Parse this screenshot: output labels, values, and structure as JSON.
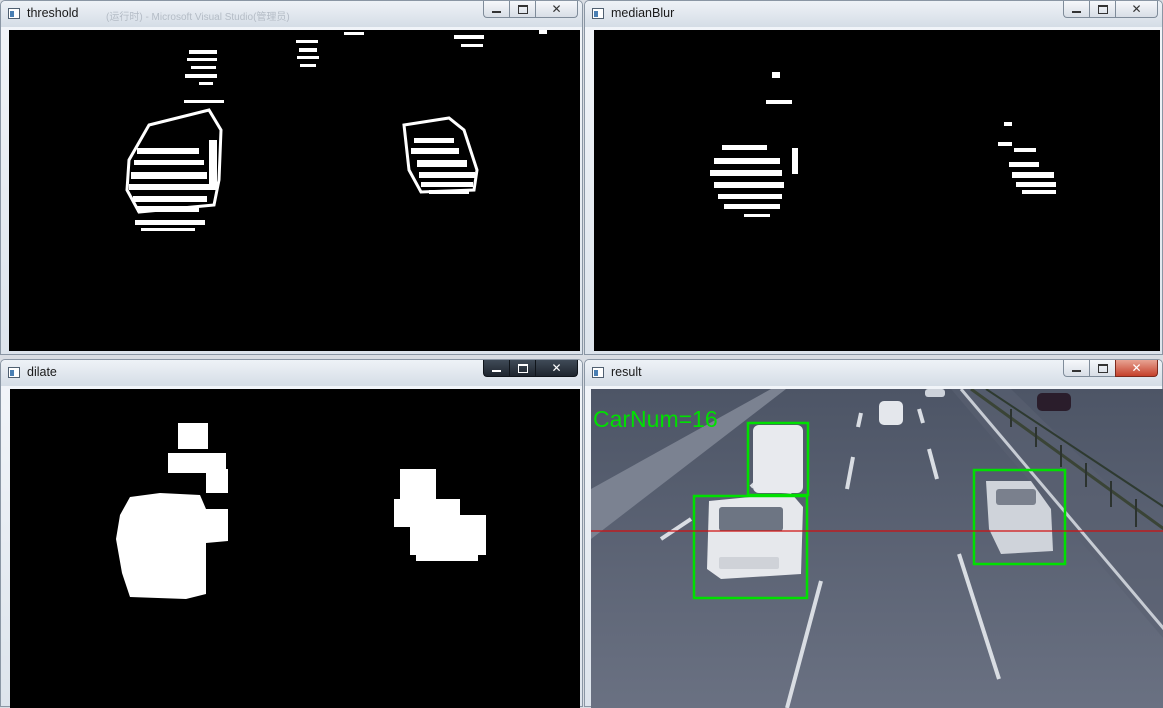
{
  "windows": {
    "threshold": {
      "title": "threshold",
      "faded_title": "(运行时) - Microsoft Visual Studio(管理员)"
    },
    "medianblur": {
      "title": "medianBlur"
    },
    "dilate": {
      "title": "dilate"
    },
    "result": {
      "title": "result",
      "overlay_text": "CarNum=16"
    }
  },
  "controls": {
    "minimize": "minimize-icon",
    "maximize": "maximize-icon",
    "close": "close-icon"
  },
  "colors": {
    "detection_box": "#00e000",
    "count_line": "#d01010",
    "count_text": "#00e000",
    "mask_foreground": "#ffffff",
    "mask_background": "#000000"
  }
}
